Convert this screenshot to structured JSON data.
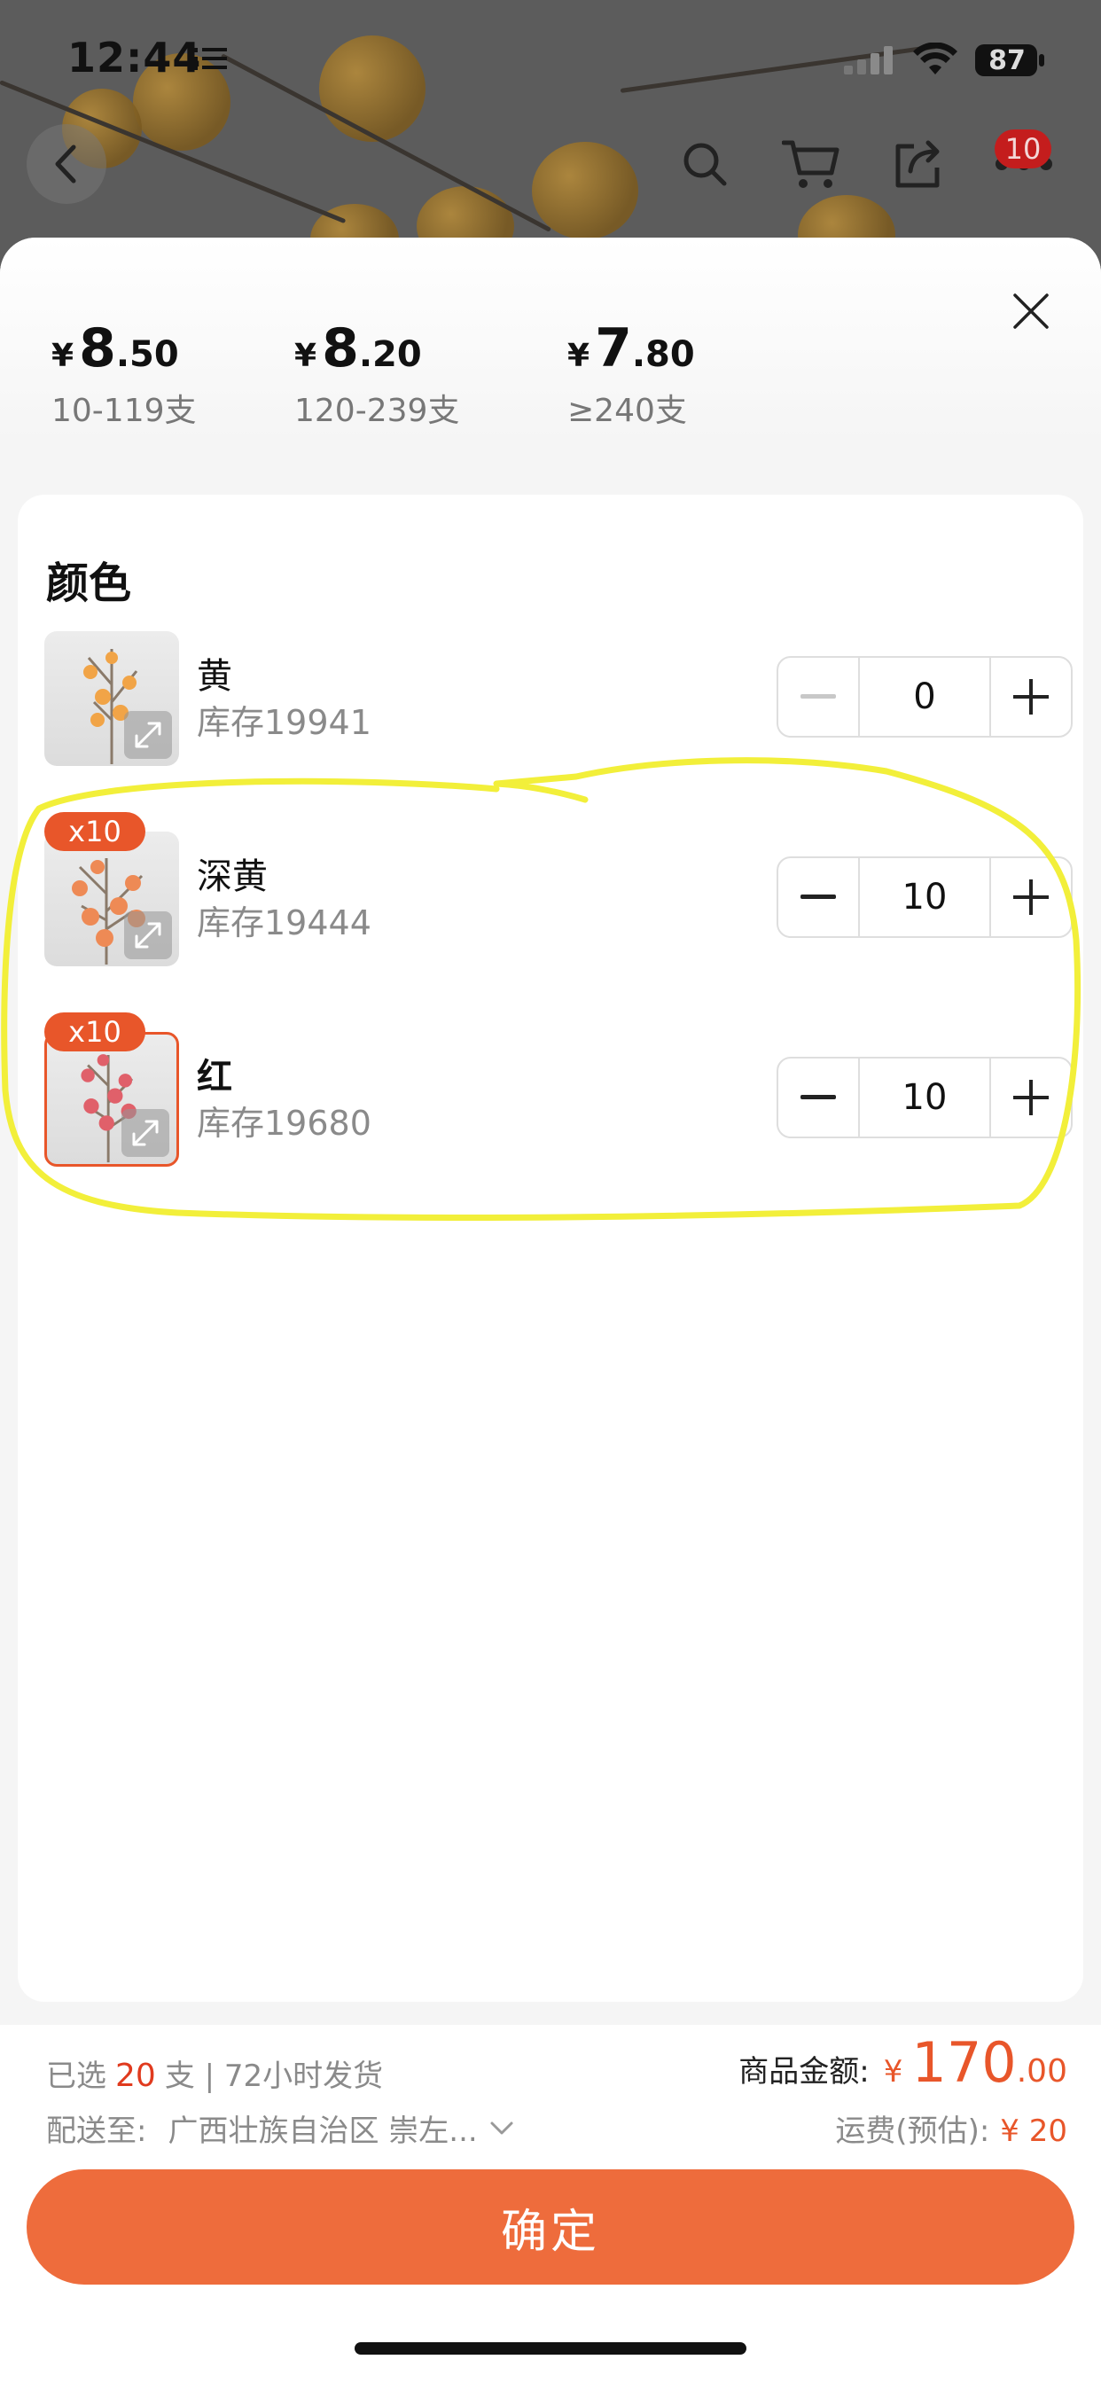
{
  "status_bar": {
    "time": "12:44",
    "battery": "87"
  },
  "nav": {
    "cart_badge": "10",
    "icons": [
      "back-icon",
      "search-icon",
      "cart-icon",
      "share-icon",
      "more-icon"
    ]
  },
  "price_tiers": [
    {
      "currency": "¥",
      "integer": "8",
      "decimal": ".50",
      "quantity": "10-119支"
    },
    {
      "currency": "¥",
      "integer": "8",
      "decimal": ".20",
      "quantity": "120-239支"
    },
    {
      "currency": "¥",
      "integer": "7",
      "decimal": ".80",
      "quantity": "≥240支"
    }
  ],
  "section": {
    "title": "颜色"
  },
  "variants": [
    {
      "name": "黄",
      "stock": "库存19941",
      "quantity": "0",
      "badge": ""
    },
    {
      "name": "深黄",
      "stock": "库存19444",
      "quantity": "10",
      "badge": "x10"
    },
    {
      "name": "红",
      "stock": "库存19680",
      "quantity": "10",
      "badge": "x10"
    }
  ],
  "footer": {
    "selected_prefix": "已选",
    "selected_count": "20",
    "selected_suffix": "支 | 72小时发货",
    "ship_label": "配送至:",
    "ship_address": "广西壮族自治区 崇左...",
    "total_label": "商品金额:",
    "total_currency": "¥",
    "total_integer": "170",
    "total_decimal": ".00",
    "freight_label": "运费(预估):",
    "freight_value": "¥ 20",
    "confirm_label": "确定"
  },
  "colors": {
    "accent": "#e8562a",
    "confirm_button": "#ee6c3c",
    "highlight_annotation": "#f2ef3a"
  }
}
